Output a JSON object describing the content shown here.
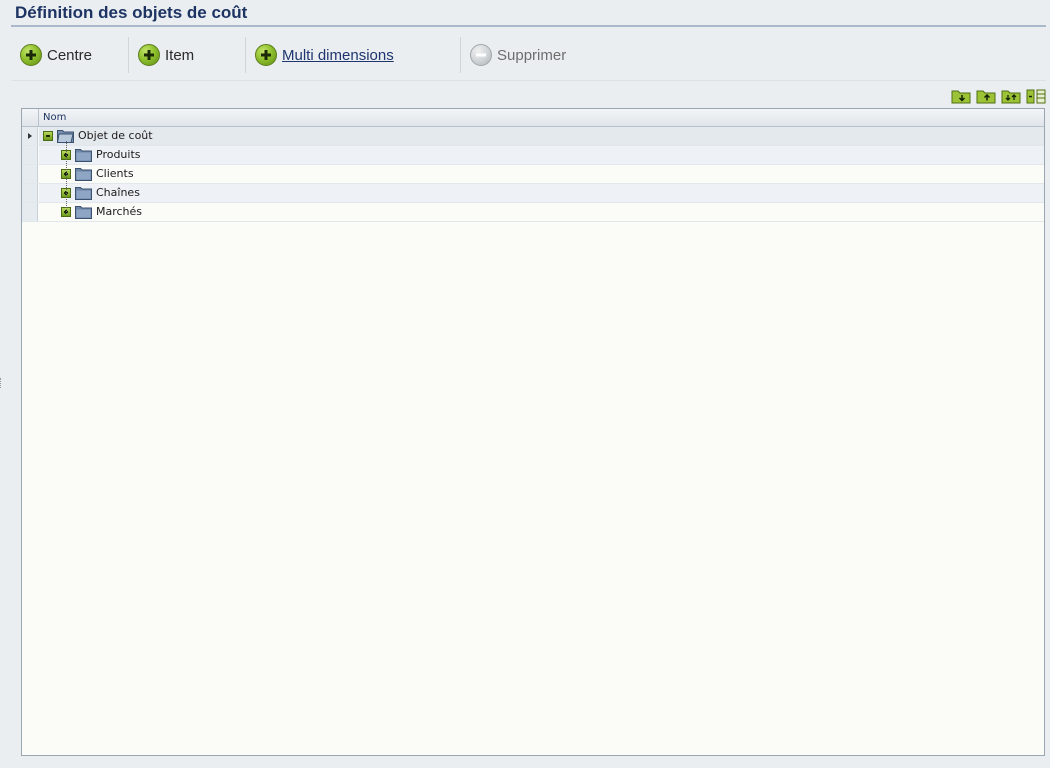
{
  "page": {
    "title": "Définition des objets de coût"
  },
  "toolbar": {
    "buttons": [
      {
        "label": "Centre",
        "icon": "plus-circle-icon",
        "enabled": true,
        "link": false
      },
      {
        "label": "Item",
        "icon": "plus-circle-icon",
        "enabled": true,
        "link": false
      },
      {
        "label": "Multi dimensions",
        "icon": "plus-circle-icon",
        "enabled": true,
        "link": true
      },
      {
        "label": "Supprimer",
        "icon": "minus-circle-icon",
        "enabled": false,
        "link": false
      }
    ]
  },
  "mini_tools": [
    {
      "icon": "folder-expand-icon"
    },
    {
      "icon": "folder-collapse-icon"
    },
    {
      "icon": "folder-expand-all-icon"
    },
    {
      "icon": "columns-icon"
    }
  ],
  "grid": {
    "columns": [
      "Nom"
    ],
    "tree": {
      "root": {
        "label": "Objet de coût",
        "expanded": true
      },
      "children": [
        {
          "label": "Produits",
          "expanded": false
        },
        {
          "label": "Clients",
          "expanded": false
        },
        {
          "label": "Chaînes",
          "expanded": false
        },
        {
          "label": "Marchés",
          "expanded": false
        }
      ]
    }
  },
  "colors": {
    "title": "#1d3463",
    "accent_green": "#8fc12d",
    "link": "#1f3570"
  }
}
